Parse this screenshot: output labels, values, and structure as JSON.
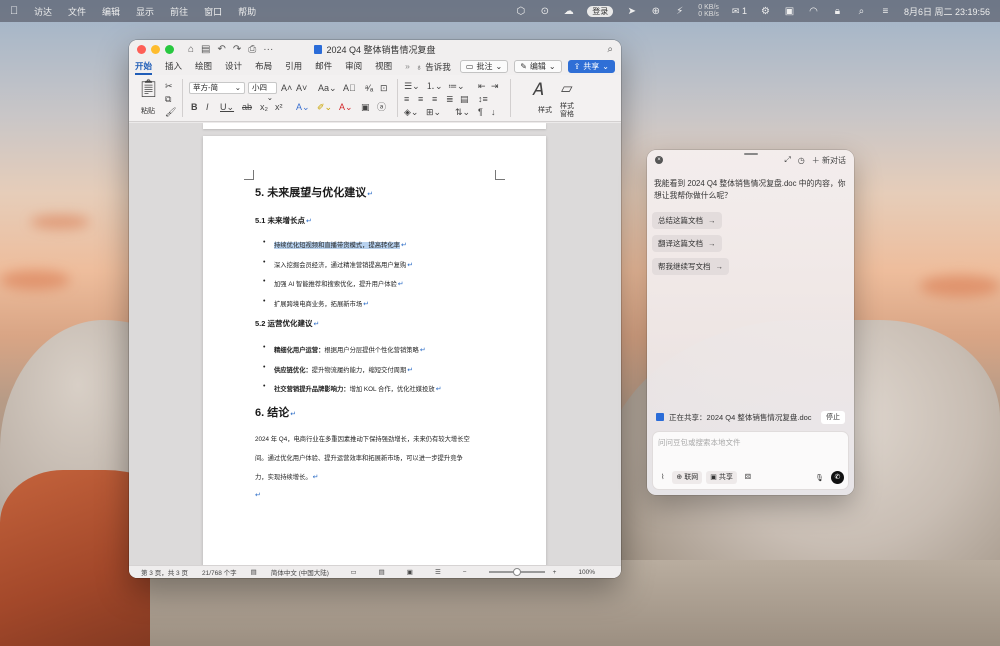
{
  "menubar": {
    "items": [
      "访达",
      "文件",
      "编辑",
      "显示",
      "前往",
      "窗口",
      "帮助"
    ],
    "status_pill": "登录",
    "net_up": "0 KB/s",
    "net_down": "0 KB/s",
    "notif_count": "1",
    "datetime": "8月6日 周二  23:19:56"
  },
  "word": {
    "title": "2024 Q4 整体销售情况复盘",
    "tabs": [
      "开始",
      "插入",
      "绘图",
      "设计",
      "布局",
      "引用",
      "邮件",
      "审阅",
      "视图"
    ],
    "tell_me": "告诉我",
    "comment_btn": "批注",
    "edit_btn": "编辑",
    "share_btn": "共享",
    "ribbon": {
      "paste": "粘贴",
      "font_name": "苹方-简",
      "font_size": "小四",
      "styles": "样式",
      "styles_pane": "样式窗格"
    },
    "doc": {
      "h5": "5. 未来展望与优化建议",
      "h5_1": "5.1 未来增长点",
      "growth": [
        "持续优化短视频和直播带货模式，提高转化率",
        "深入挖掘会员经济，通过精准营销提高用户复购",
        "加强 AI 智能推荐和搜索优化，提升用户体验",
        "扩展跨境电商业务，拓展新市场"
      ],
      "h5_2": "5.2 运营优化建议",
      "ops": [
        {
          "bold": "精细化用户运营：",
          "text": "根据用户分层提供个性化营销策略"
        },
        {
          "bold": "供应链优化：",
          "text": "提升物流履约能力，缩短交付周期"
        },
        {
          "bold": "社交营销提升品牌影响力：",
          "text": "增加 KOL 合作，优化社媒投放"
        }
      ],
      "h6": "6. 结论",
      "conclusion_1": "2024 年 Q4，电商行业在多重因素推动下保持强劲增长，未来仍有较大增长空",
      "conclusion_2": "间。通过优化用户体验、提升运营效率和拓展新市场，可以进一步提升竞争",
      "conclusion_3": "力，实现持续增长。"
    },
    "status": {
      "page": "第 3 页，共 3 页",
      "words": "21/768 个字",
      "lang": "简体中文 (中国大陆)",
      "zoom": "100%",
      "zoom_level": 0.5
    }
  },
  "assistant": {
    "new_chat": "新对话",
    "message": "我能看到 2024 Q4 整体销售情况复盘.doc 中的内容，你想让我帮你做什么呢？",
    "chips": [
      "总结这篇文档",
      "翻译这篇文档",
      "帮我继续写文档"
    ],
    "sharing": "正在共享：2024 Q4 整体销售情况复盘.doc",
    "stop": "停止",
    "input_placeholder": "问问豆包或搜索本地文件",
    "tools": [
      "联网",
      "共享"
    ]
  }
}
